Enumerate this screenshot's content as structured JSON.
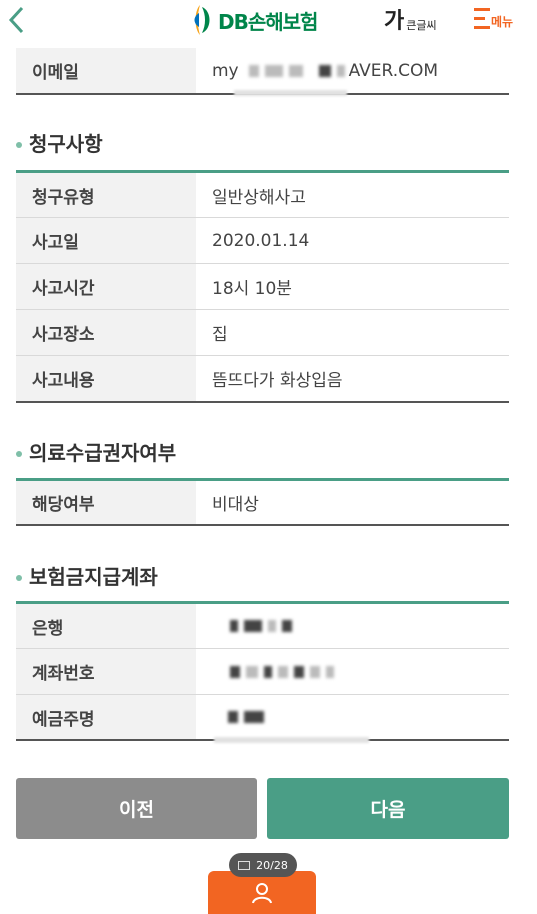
{
  "header": {
    "logo_text": "DB손해보험",
    "bigfont_glyph": "가",
    "bigfont_label": "큰글씨",
    "menu_label": "메뉴",
    "brand_color": "#00854a",
    "accent_color": "#f26522"
  },
  "email_row": {
    "label": "이메일",
    "value_prefix": "my",
    "value_suffix": "AVER.COM"
  },
  "claim_section": {
    "title": "청구사항",
    "rows": [
      {
        "label": "청구유형",
        "value": "일반상해사고"
      },
      {
        "label": "사고일",
        "value": "2020.01.14"
      },
      {
        "label": "사고시간",
        "value": "18시 10분"
      },
      {
        "label": "사고장소",
        "value": "집"
      },
      {
        "label": "사고내용",
        "value": "뜸뜨다가 화상입음"
      }
    ]
  },
  "medical_section": {
    "title": "의료수급권자여부",
    "rows": [
      {
        "label": "해당여부",
        "value": "비대상"
      }
    ]
  },
  "account_section": {
    "title": "보험금지급계좌",
    "rows": [
      {
        "label": "은행"
      },
      {
        "label": "계좌번호"
      },
      {
        "label": "예금주명"
      }
    ]
  },
  "buttons": {
    "prev_label": "이전",
    "next_label": "다음"
  },
  "page_counter": "20/28",
  "theme": {
    "teal": "#4a9e86",
    "gray_button": "#8c8c8c"
  }
}
